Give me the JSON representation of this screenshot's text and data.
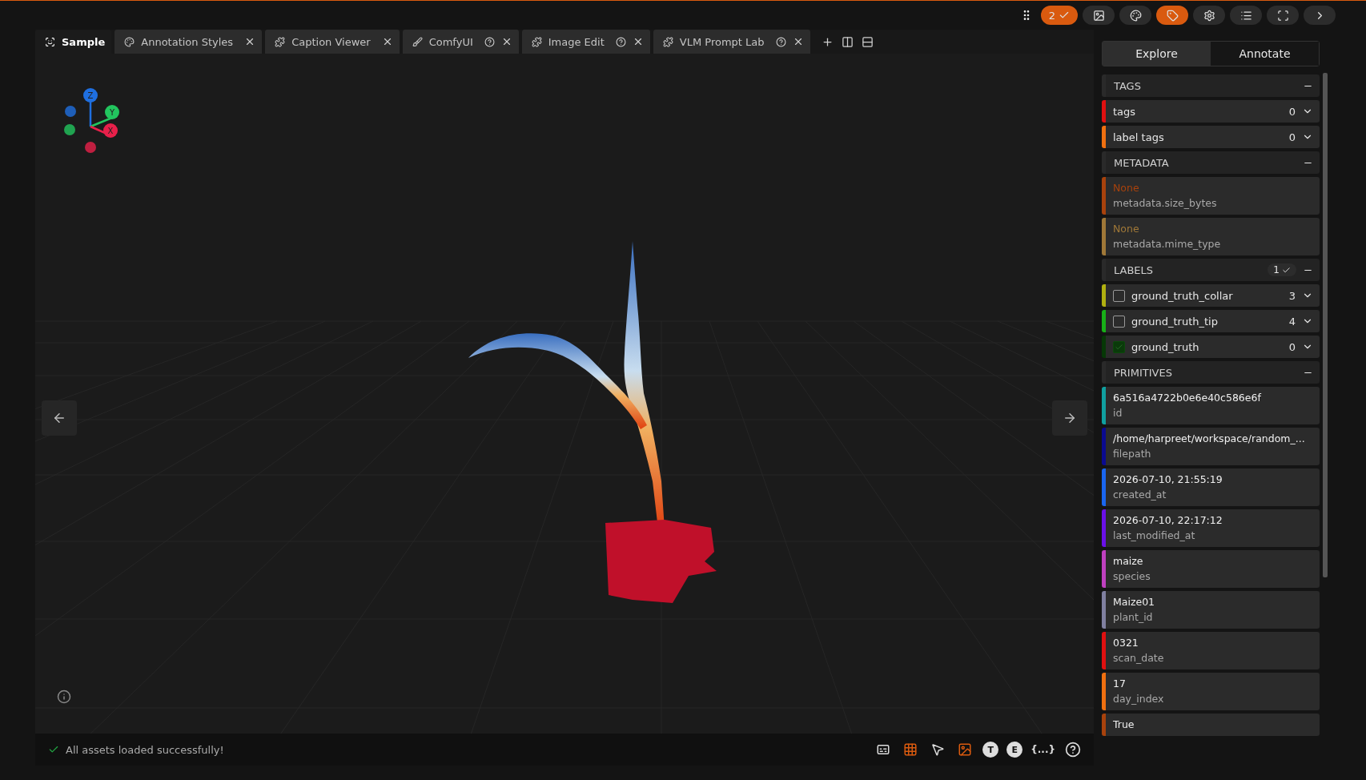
{
  "toolbar": {
    "count_badge": "2",
    "buttons": [
      {
        "kind": "image",
        "selected": false
      },
      {
        "kind": "palette",
        "selected": false
      },
      {
        "kind": "tag",
        "selected": true
      },
      {
        "kind": "settings",
        "selected": false
      },
      {
        "kind": "list",
        "selected": false
      },
      {
        "kind": "fullscreen",
        "selected": false
      },
      {
        "kind": "next",
        "selected": false
      }
    ]
  },
  "tabs": [
    {
      "kind": "sample",
      "label": "Sample",
      "selected": true,
      "help": false,
      "closable": false
    },
    {
      "kind": "palette",
      "label": "Annotation Styles",
      "selected": false,
      "help": false,
      "closable": true
    },
    {
      "kind": "plugin",
      "label": "Caption Viewer",
      "selected": false,
      "help": false,
      "closable": true
    },
    {
      "kind": "brush",
      "label": "ComfyUI",
      "selected": false,
      "help": true,
      "closable": true
    },
    {
      "kind": "plugin",
      "label": "Image Edit",
      "selected": false,
      "help": true,
      "closable": true
    },
    {
      "kind": "plugin",
      "label": "VLM Prompt Lab",
      "selected": false,
      "help": true,
      "closable": true
    }
  ],
  "viewer": {
    "axes": [
      {
        "label": "Z",
        "color": "#1f6fe0"
      },
      {
        "label": "Y",
        "color": "#22c55e"
      },
      {
        "label": "X",
        "color": "#e8204a"
      }
    ],
    "status": "All assets loaded successfully!",
    "tools": [
      {
        "kind": "captions",
        "active": false
      },
      {
        "kind": "grid",
        "active": true
      },
      {
        "kind": "pointer",
        "active": false
      },
      {
        "kind": "frame",
        "active": true
      },
      {
        "kind": "letter",
        "label": "T",
        "active": false
      },
      {
        "kind": "letter",
        "label": "E",
        "active": false
      },
      {
        "kind": "json",
        "label": "{...}",
        "active": false
      },
      {
        "kind": "help",
        "active": false
      }
    ]
  },
  "sidebar": {
    "modes": [
      {
        "label": "Explore",
        "selected": true
      },
      {
        "label": "Annotate",
        "selected": false
      }
    ],
    "sections": [
      {
        "title": "TAGS",
        "items": [
          {
            "kind": "tag",
            "name": "tags",
            "count": "0",
            "color": "#e01010"
          },
          {
            "kind": "tag",
            "name": "label tags",
            "count": "0",
            "color": "#f07010"
          }
        ]
      },
      {
        "title": "METADATA",
        "items": [
          {
            "kind": "field",
            "value": "None",
            "name": "metadata.size_bytes",
            "empty": true,
            "color": "#a8420c"
          },
          {
            "kind": "field",
            "value": "None",
            "name": "metadata.mime_type",
            "empty": true,
            "color": "#a07838"
          }
        ]
      },
      {
        "title": "LABELS",
        "badge": "1",
        "items": [
          {
            "kind": "label",
            "name": "ground_truth_collar",
            "count": "3",
            "checked": false,
            "color": "#b0b010"
          },
          {
            "kind": "label",
            "name": "ground_truth_tip",
            "count": "4",
            "checked": false,
            "color": "#18b018"
          },
          {
            "kind": "label",
            "name": "ground_truth",
            "count": "0",
            "checked": true,
            "color": "#063806"
          }
        ]
      },
      {
        "title": "PRIMITIVES",
        "items": [
          {
            "kind": "field",
            "value": "6a516a4722b0e6e40c586e6f",
            "name": "id",
            "empty": false,
            "color": "#10a0a0"
          },
          {
            "kind": "field",
            "value": "/home/harpreet/workspace/random_...",
            "name": "filepath",
            "empty": false,
            "color": "#0a0a90"
          },
          {
            "kind": "field",
            "value": "2026-07-10, 21:55:19",
            "name": "created_at",
            "empty": false,
            "color": "#1a66f0"
          },
          {
            "kind": "field",
            "value": "2026-07-10, 22:17:12",
            "name": "last_modified_at",
            "empty": false,
            "color": "#6a10e8"
          },
          {
            "kind": "field",
            "value": "maize",
            "name": "species",
            "empty": false,
            "color": "#c040c0"
          },
          {
            "kind": "field",
            "value": "Maize01",
            "name": "plant_id",
            "empty": false,
            "color": "#8080a0"
          },
          {
            "kind": "field",
            "value": "0321",
            "name": "scan_date",
            "empty": false,
            "color": "#e01010"
          },
          {
            "kind": "field",
            "value": "17",
            "name": "day_index",
            "empty": false,
            "color": "#f07010"
          },
          {
            "kind": "field",
            "value": "True",
            "empty": false,
            "color": "#a8420c"
          }
        ]
      }
    ]
  }
}
